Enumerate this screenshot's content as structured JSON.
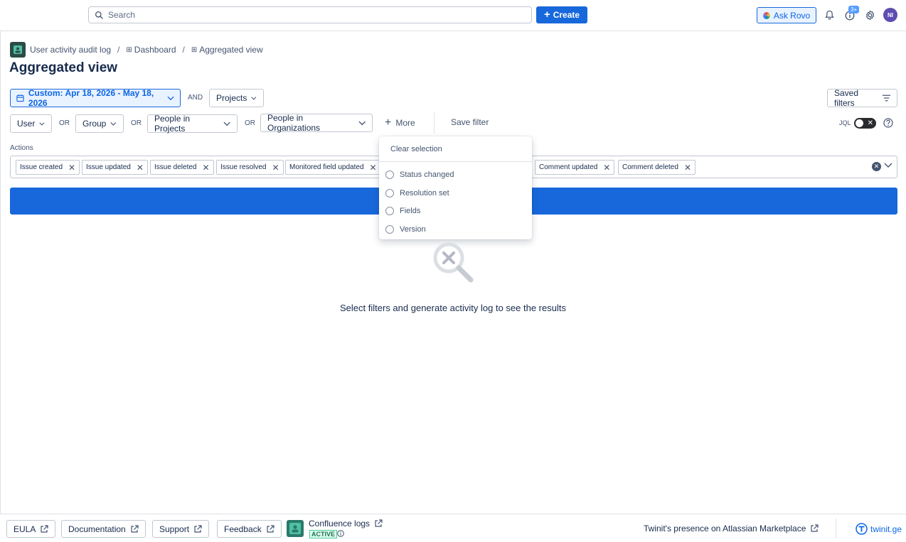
{
  "topbar": {
    "search_placeholder": "Search",
    "create_label": "Create",
    "ask_rovo_label": "Ask Rovo",
    "notification_count": "3+",
    "avatar_initials": "NI"
  },
  "breadcrumb": {
    "items": [
      "User activity audit log",
      "Dashboard",
      "Aggregated view"
    ]
  },
  "page_title": "Aggregated view",
  "filters": {
    "date_range": "Custom: Apr 18, 2026 - May 18, 2026",
    "and_label": "AND",
    "projects_label": "Projects",
    "saved_filters_label": "Saved filters",
    "user_label": "User",
    "group_label": "Group",
    "people_in_projects_label": "People in Projects",
    "people_in_orgs_label": "People in Organizations",
    "or_label": "OR",
    "more_label": "More",
    "save_filter_label": "Save filter",
    "jql_label": "JQL"
  },
  "actions": {
    "label": "Actions",
    "tags": [
      "Issue created",
      "Issue updated",
      "Issue deleted",
      "Issue resolved",
      "Monitored field updated",
      "Comment updated",
      "Comment deleted"
    ]
  },
  "more_popup": {
    "clear_label": "Clear selection",
    "options": [
      "Status changed",
      "Resolution set",
      "Fields",
      "Version"
    ]
  },
  "empty_state": {
    "message": "Select filters and generate activity log to see the results"
  },
  "footer": {
    "eula": "EULA",
    "documentation": "Documentation",
    "support": "Support",
    "feedback": "Feedback",
    "confluence_logs": "Confluence logs",
    "active_badge": "ACTIVE",
    "marketplace": "Twinit's presence on Atlassian Marketplace",
    "brand": "twinit.ge"
  },
  "colors": {
    "primary": "#1868db",
    "primary_text": "#0c66e4",
    "border": "#c1c7d0",
    "text": "#172b4d",
    "subtle_text": "#44546f"
  }
}
